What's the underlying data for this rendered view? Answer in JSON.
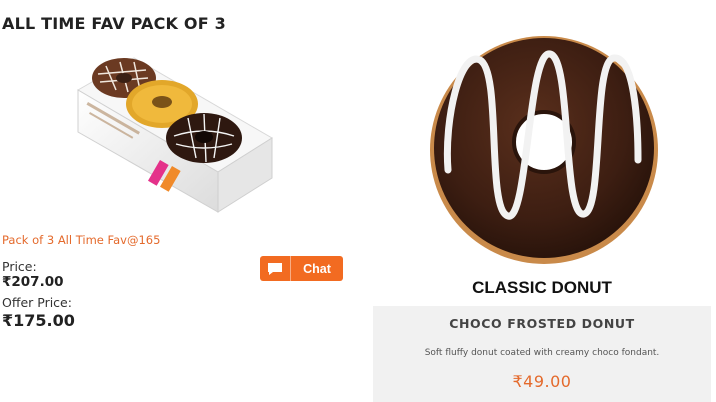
{
  "left_product": {
    "title": "ALL TIME FAV PACK OF 3",
    "promo": "Pack of 3 All Time Fav@165",
    "price_label": "Price:",
    "price_value": "₹207.00",
    "offer_label": "Offer Price:",
    "offer_value": "₹175.00",
    "chat_label": "Chat",
    "chat_icon": "speech-bubble-icon"
  },
  "right_product": {
    "heading": "CLASSIC DONUT",
    "name": "CHOCO FROSTED DONUT",
    "description": "Soft fluffy donut coated with creamy choco fondant.",
    "price": "₹49.00"
  },
  "colors": {
    "accent": "#f26b21",
    "price_orange": "#e46a2c",
    "panel_bg": "#f1f1f1",
    "chocolate": "#3b1d12",
    "icing": "#f2f2f2"
  }
}
